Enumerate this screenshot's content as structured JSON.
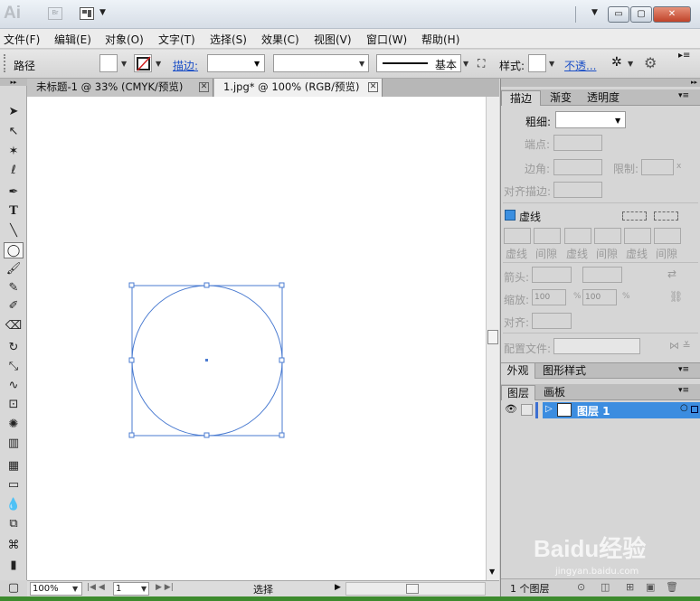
{
  "title": {
    "logo": "Ai",
    "bridge": "Br",
    "min": "▭",
    "max": "▢",
    "close": "✕"
  },
  "menu": [
    "文件(F)",
    "编辑(E)",
    "对象(O)",
    "文字(T)",
    "选择(S)",
    "效果(C)",
    "视图(V)",
    "窗口(W)",
    "帮助(H)"
  ],
  "control": {
    "selection_label": "路径",
    "stroke_label": "描边:",
    "brush_label": "基本",
    "style_label": "样式:",
    "opacity_label": "不透..."
  },
  "tabs": [
    {
      "label": "未标题-1 @ 33% (CMYK/预览)",
      "active": false
    },
    {
      "label": "1.jpg* @ 100% (RGB/预览)",
      "active": true
    }
  ],
  "status": {
    "zoom": "100%",
    "artboard": "1",
    "tool": "选择"
  },
  "stroke_panel": {
    "tabs": [
      "描边",
      "渐变",
      "透明度"
    ],
    "weight_label": "粗细:",
    "cap_label": "端点:",
    "corner_label": "边角:",
    "limit_label": "限制:",
    "limit_x": "x",
    "align_label": "对齐描边:",
    "dashed_label": "虚线",
    "dash_headers": [
      "虚线",
      "间隙",
      "虚线",
      "间隙",
      "虚线",
      "间隙"
    ],
    "arrow_label": "箭头:",
    "scale_label": "缩放:",
    "scale_values": [
      "100",
      "100"
    ],
    "percent": "%",
    "align2_label": "对齐:",
    "profile_label": "配置文件:"
  },
  "appearance_panel": {
    "tabs": [
      "外观",
      "图形样式"
    ]
  },
  "layers_panel": {
    "tabs": [
      "图层",
      "画板"
    ],
    "layers": [
      {
        "name": "图层 1",
        "selected": true
      }
    ],
    "count": "1 个图层"
  },
  "watermark": {
    "brand": "Baidu经验",
    "url": "jingyan.baidu.com"
  },
  "colors": {
    "accent": "#3b8fe0",
    "selection": "#4a7bd1",
    "layer_highlight": "#3c8de0"
  }
}
